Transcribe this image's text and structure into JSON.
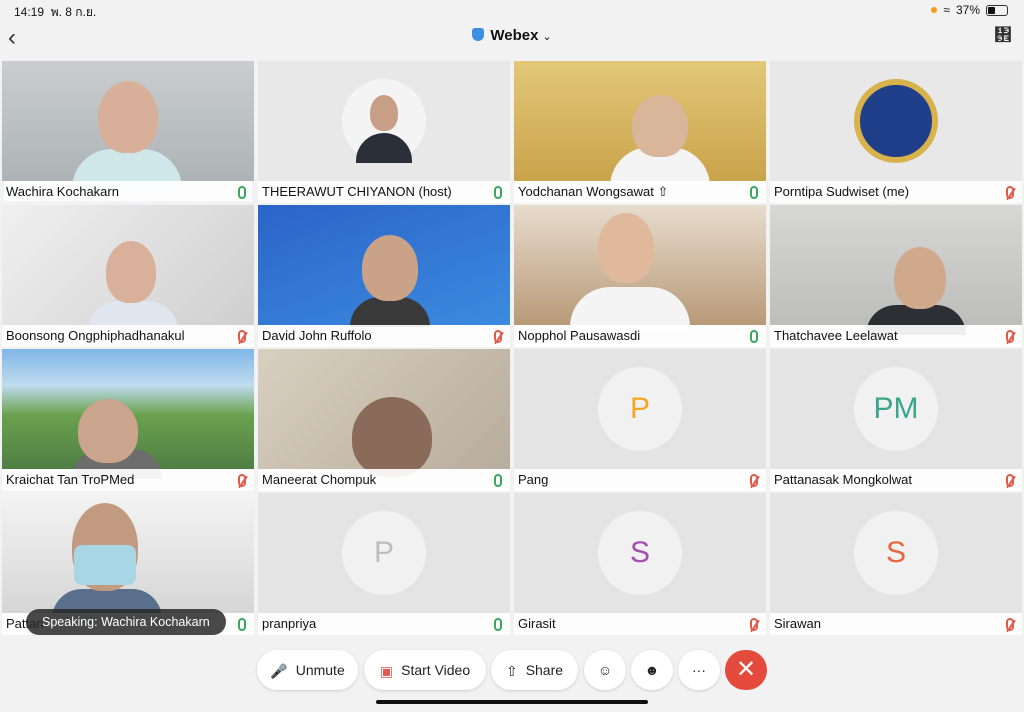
{
  "status_bar": {
    "time": "14:19",
    "date": "พ. 8 ก.ย.",
    "battery": "37%"
  },
  "header": {
    "title": "Webex",
    "back_icon": "chevron-left-icon",
    "bluetooth_icon": "bluetooth-icon"
  },
  "participants": [
    {
      "name": "Wachira Kochakarn",
      "mic": "on",
      "active": true
    },
    {
      "name": "THEERAWUT CHIYANON (host)",
      "mic": "on"
    },
    {
      "name": "Yodchanan Wongsawat",
      "mic": "on",
      "sharing": true
    },
    {
      "name": "Porntipa Sudwiset (me)",
      "mic": "muted"
    },
    {
      "name": "Boonsong Ongphiphadhanakul",
      "mic": "muted"
    },
    {
      "name": "David John Ruffolo",
      "mic": "muted"
    },
    {
      "name": "Nopphol Pausawasdi",
      "mic": "on"
    },
    {
      "name": "Thatchavee Leelawat",
      "mic": "muted"
    },
    {
      "name": "Kraichat Tan TroPMed",
      "mic": "muted"
    },
    {
      "name": "Maneerat Chompuk",
      "mic": "on"
    },
    {
      "name": "Pang",
      "mic": "muted",
      "initials": "P",
      "initials_color": "#f5a623"
    },
    {
      "name": "Pattanasak Mongkolwat",
      "mic": "muted",
      "initials": "PM",
      "initials_color": "#3aa48c"
    },
    {
      "name": "Pattan",
      "mic": "on"
    },
    {
      "name": "pranpriya",
      "mic": "on",
      "initials": "P",
      "initials_color": "#bdbdbd"
    },
    {
      "name": "Girasit",
      "mic": "muted",
      "initials": "S",
      "initials_color": "#a24fb0"
    },
    {
      "name": "Sirawan",
      "mic": "muted",
      "initials": "S",
      "initials_color": "#e8683d"
    }
  ],
  "speaking_banner": "Speaking: Wachira Kochakarn",
  "controls": {
    "unmute": "Unmute",
    "start_video": "Start Video",
    "share": "Share",
    "more": "···"
  }
}
